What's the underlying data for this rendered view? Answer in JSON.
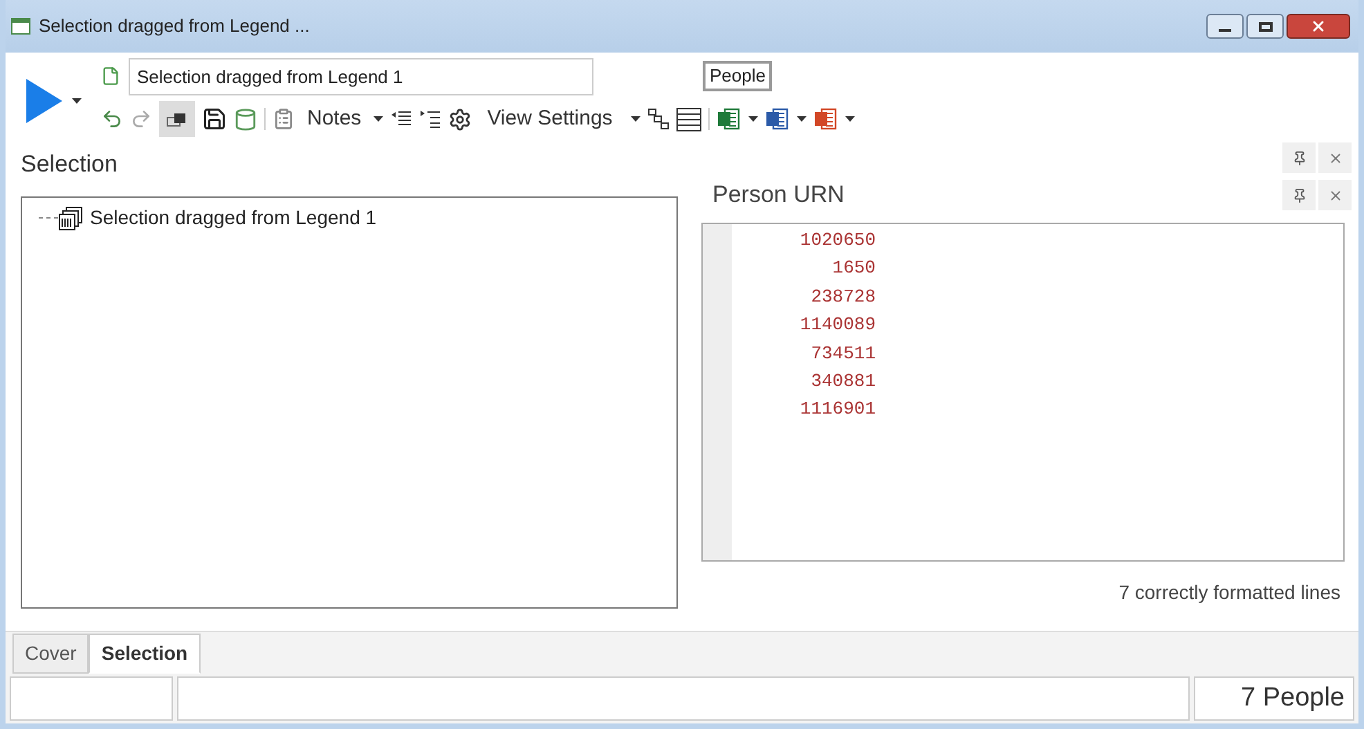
{
  "window": {
    "title": "Selection dragged from Legend ..."
  },
  "toolbar": {
    "name_field": {
      "value": "Selection dragged from Legend 1"
    },
    "type_badge": "People",
    "notes_label": "Notes",
    "view_settings_label": "View Settings"
  },
  "selection_panel": {
    "title": "Selection",
    "tree": [
      {
        "label": "Selection dragged from Legend 1"
      }
    ]
  },
  "urn_panel": {
    "title": "Person URN",
    "lines": [
      "1020650",
      "1650",
      "238728",
      "1140089",
      "734511",
      "340881",
      "1116901"
    ],
    "status": "7 correctly formatted lines"
  },
  "tabs": [
    {
      "label": "Cover",
      "selected": false
    },
    {
      "label": "Selection",
      "selected": true
    }
  ],
  "status_bar": {
    "count": "7 People"
  }
}
